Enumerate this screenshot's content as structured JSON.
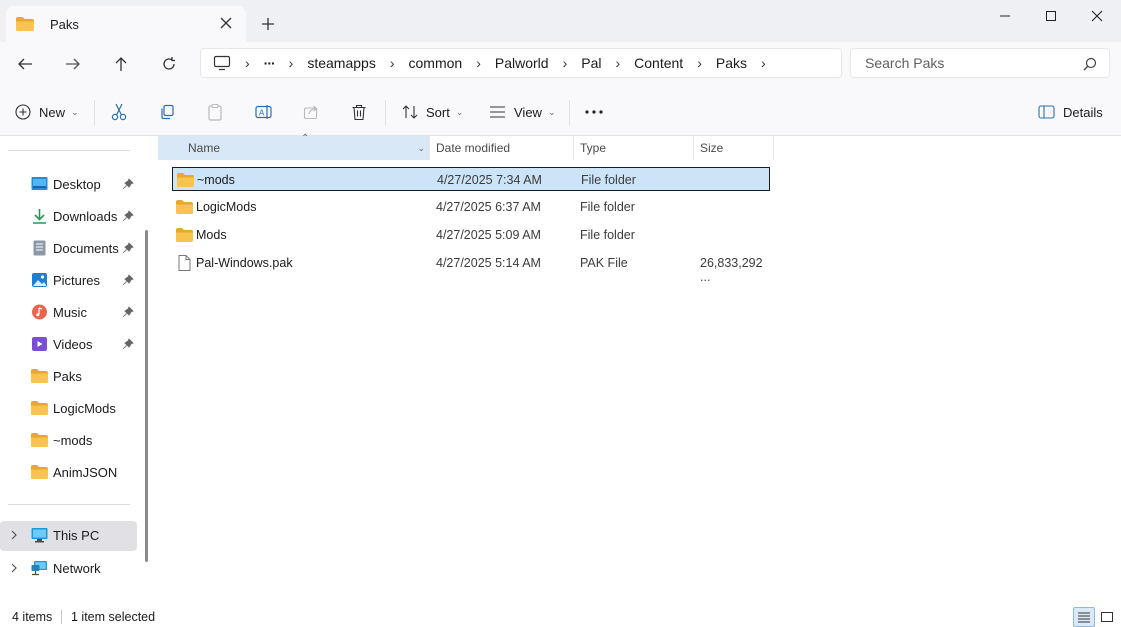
{
  "window": {
    "tab_title": "Paks",
    "colors": {
      "folder": "#f8c44f",
      "folder_dark": "#e6a928",
      "selection": "#cce4f7",
      "header_active": "#d9e8f6"
    }
  },
  "address": {
    "overflow": "···",
    "crumbs": [
      "steamapps",
      "common",
      "Palworld",
      "Pal",
      "Content",
      "Paks"
    ]
  },
  "search": {
    "placeholder": "Search Paks"
  },
  "commands": {
    "new_label": "New",
    "sort_label": "Sort",
    "view_label": "View",
    "more_label": "···",
    "details_label": "Details"
  },
  "sidebar": {
    "quick_access": [
      {
        "label": "Desktop",
        "icon": "desktop-icon",
        "pinned": true
      },
      {
        "label": "Downloads",
        "icon": "downloads-icon",
        "pinned": true
      },
      {
        "label": "Documents",
        "icon": "documents-icon",
        "pinned": true
      },
      {
        "label": "Pictures",
        "icon": "pictures-icon",
        "pinned": true
      },
      {
        "label": "Music",
        "icon": "music-icon",
        "pinned": true
      },
      {
        "label": "Videos",
        "icon": "videos-icon",
        "pinned": true
      },
      {
        "label": "Paks",
        "icon": "folder-icon",
        "pinned": false
      },
      {
        "label": "LogicMods",
        "icon": "folder-icon",
        "pinned": false
      },
      {
        "label": "~mods",
        "icon": "folder-icon",
        "pinned": false
      },
      {
        "label": "AnimJSON",
        "icon": "folder-icon",
        "pinned": false
      }
    ],
    "this_pc": "This PC",
    "network": "Network"
  },
  "columns": {
    "name": "Name",
    "date": "Date modified",
    "type": "Type",
    "size": "Size"
  },
  "files": [
    {
      "name": "~mods",
      "date": "4/27/2025 7:34 AM",
      "type": "File folder",
      "size": "",
      "kind": "folder",
      "selected": true
    },
    {
      "name": "LogicMods",
      "date": "4/27/2025 6:37 AM",
      "type": "File folder",
      "size": "",
      "kind": "folder",
      "selected": false
    },
    {
      "name": "Mods",
      "date": "4/27/2025 5:09 AM",
      "type": "File folder",
      "size": "",
      "kind": "folder",
      "selected": false
    },
    {
      "name": "Pal-Windows.pak",
      "date": "4/27/2025 5:14 AM",
      "type": "PAK File",
      "size": "26,833,292 ...",
      "kind": "file",
      "selected": false
    }
  ],
  "status": {
    "item_count": "4 items",
    "selection": "1 item selected"
  }
}
